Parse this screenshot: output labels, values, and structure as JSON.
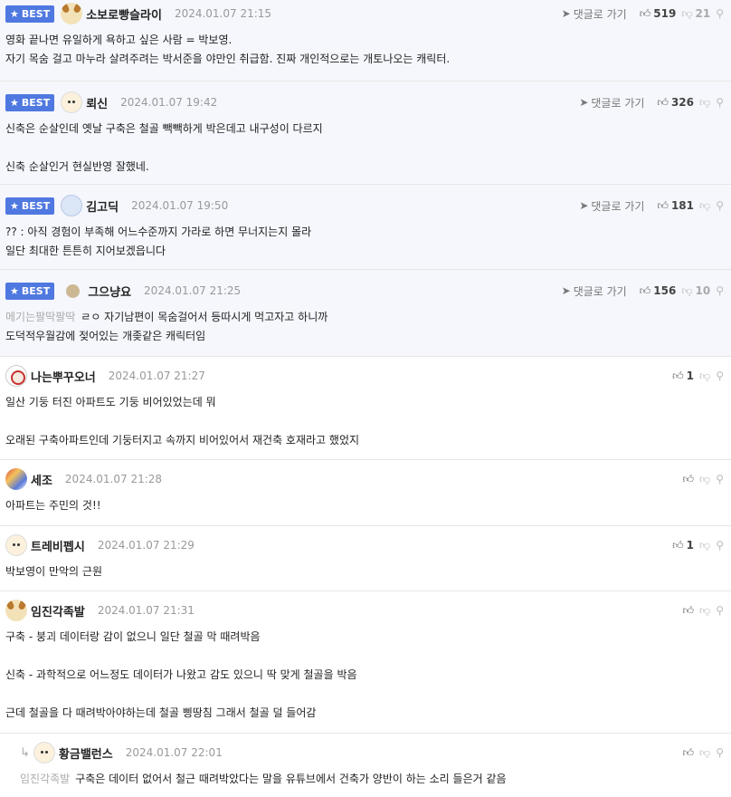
{
  "best_label": "BEST",
  "goto_label": "댓글로 가기",
  "comments": [
    {
      "nick": "소보로빵슬라이",
      "date": "2024.01.07 21:15",
      "likes": "519",
      "dislikes": "21",
      "text": "영화 끝나면 유일하게 욕하고 싶은 사람 = 박보영.\n자기 목숨 걸고 마누라 살려주려는 박서준을 야만인 취급함. 진짜 개인적으로는 개토나오는 캐릭터.",
      "mention": ""
    },
    {
      "nick": "뢰신",
      "date": "2024.01.07 19:42",
      "likes": "326",
      "dislikes": "",
      "text": "신축은 순살인데 옛날 구축은 철골 빽빽하게 박은데고 내구성이 다르지\n\n신축 순살인거 현실반영 잘했네.",
      "mention": ""
    },
    {
      "nick": "김고딕",
      "date": "2024.01.07 19:50",
      "likes": "181",
      "dislikes": "",
      "text": "?? : 아직 경험이 부족해 어느수준까지 가라로 하면 무너지는지 몰라\n일단 최대한 튼튼히 지어보겠읍니다",
      "mention": ""
    },
    {
      "nick": "그으냥요",
      "date": "2024.01.07 21:25",
      "likes": "156",
      "dislikes": "10",
      "text": "ㄹㅇ 자기남편이 목숨걸어서 등따시게 먹고자고 하니까\n도덕적우월감에 젖어있는 개좆같은 캐릭터임",
      "mention": "메기는팔딱팔딱"
    },
    {
      "nick": "나는뿌꾸오너",
      "date": "2024.01.07 21:27",
      "likes": "1",
      "text": "일산 기둥 터진 아파트도 기둥 비어있었는데 뭐\n\n오래된 구축아파트인데 기둥터지고 속까지 비어있어서 재건축 호재라고 했었지",
      "mention": ""
    },
    {
      "nick": "세조",
      "date": "2024.01.07 21:28",
      "likes": "",
      "text": "아파트는 주민의 것!!",
      "mention": ""
    },
    {
      "nick": "트레비펩시",
      "date": "2024.01.07 21:29",
      "likes": "1",
      "text": "박보영이 만악의 근원",
      "mention": ""
    },
    {
      "nick": "임진각족발",
      "date": "2024.01.07 21:31",
      "likes": "",
      "text": "구축 - 붕괴 데이터랑 감이 없으니 일단 철골 막 때려박음\n\n신축 - 과학적으로 어느정도 데이터가 나왔고 감도 있으니 딱 맞게 철골을 박음\n\n근데 철골을 다 때려박아야하는데 철골 삥땅침 그래서 철골 덜 들어감",
      "mention": ""
    },
    {
      "nick": "황금밸런스",
      "date": "2024.01.07 22:01",
      "likes": "",
      "text": "구축은 데이터 없어서 철근 때려박았다는 말을 유튜브에서 건축가 양반이 하는 소리 들은거 같음",
      "mention": "임진각족발"
    }
  ]
}
